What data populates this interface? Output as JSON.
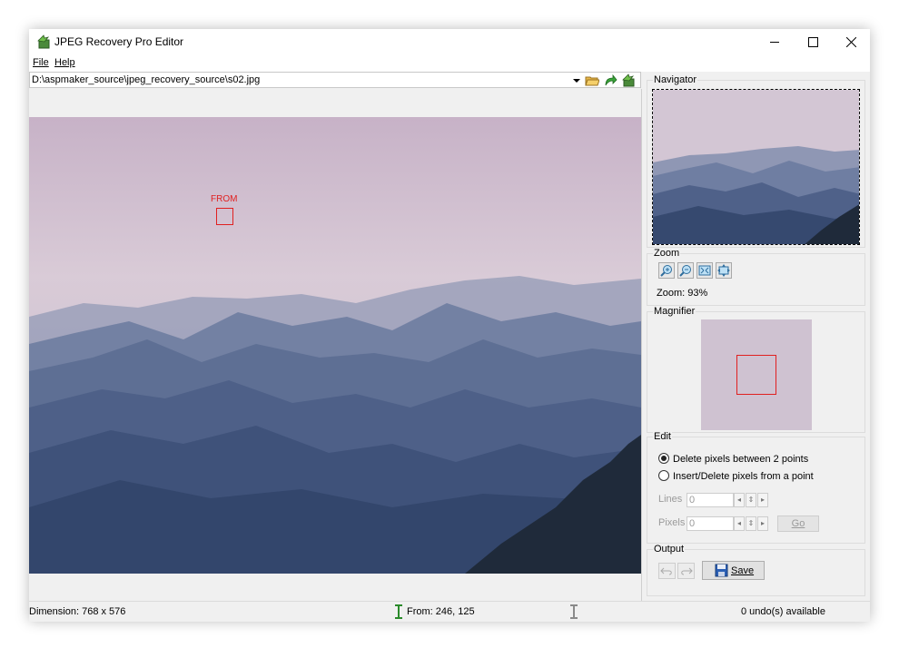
{
  "window": {
    "title": "JPEG Recovery Pro Editor"
  },
  "menu": {
    "items": [
      {
        "label": "File"
      },
      {
        "label": "Help"
      }
    ]
  },
  "path_bar": {
    "path": "D:\\aspmaker_source\\jpeg_recovery_source\\s02.jpg"
  },
  "canvas": {
    "marker_label": "FROM"
  },
  "navigator": {
    "title": "Navigator"
  },
  "zoom": {
    "title": "Zoom",
    "zoom_text": "Zoom: 93%"
  },
  "magnifier": {
    "title": "Magnifier"
  },
  "edit": {
    "title": "Edit",
    "option_delete": "Delete pixels between 2 points",
    "option_insert": "Insert/Delete pixels from a point",
    "lines_label": "Lines",
    "lines_value": "0",
    "pixels_label": "Pixels",
    "pixels_value": "0",
    "go_label": "Go"
  },
  "output": {
    "title": "Output",
    "save_label": "Save"
  },
  "status": {
    "dimension": "Dimension: 768 x 576",
    "from": "From: 246, 125",
    "undo": "0 undo(s) available"
  },
  "colors": {
    "marker": "#e02020",
    "sky": "#d8c9d6",
    "mountain": "#3a5070"
  }
}
